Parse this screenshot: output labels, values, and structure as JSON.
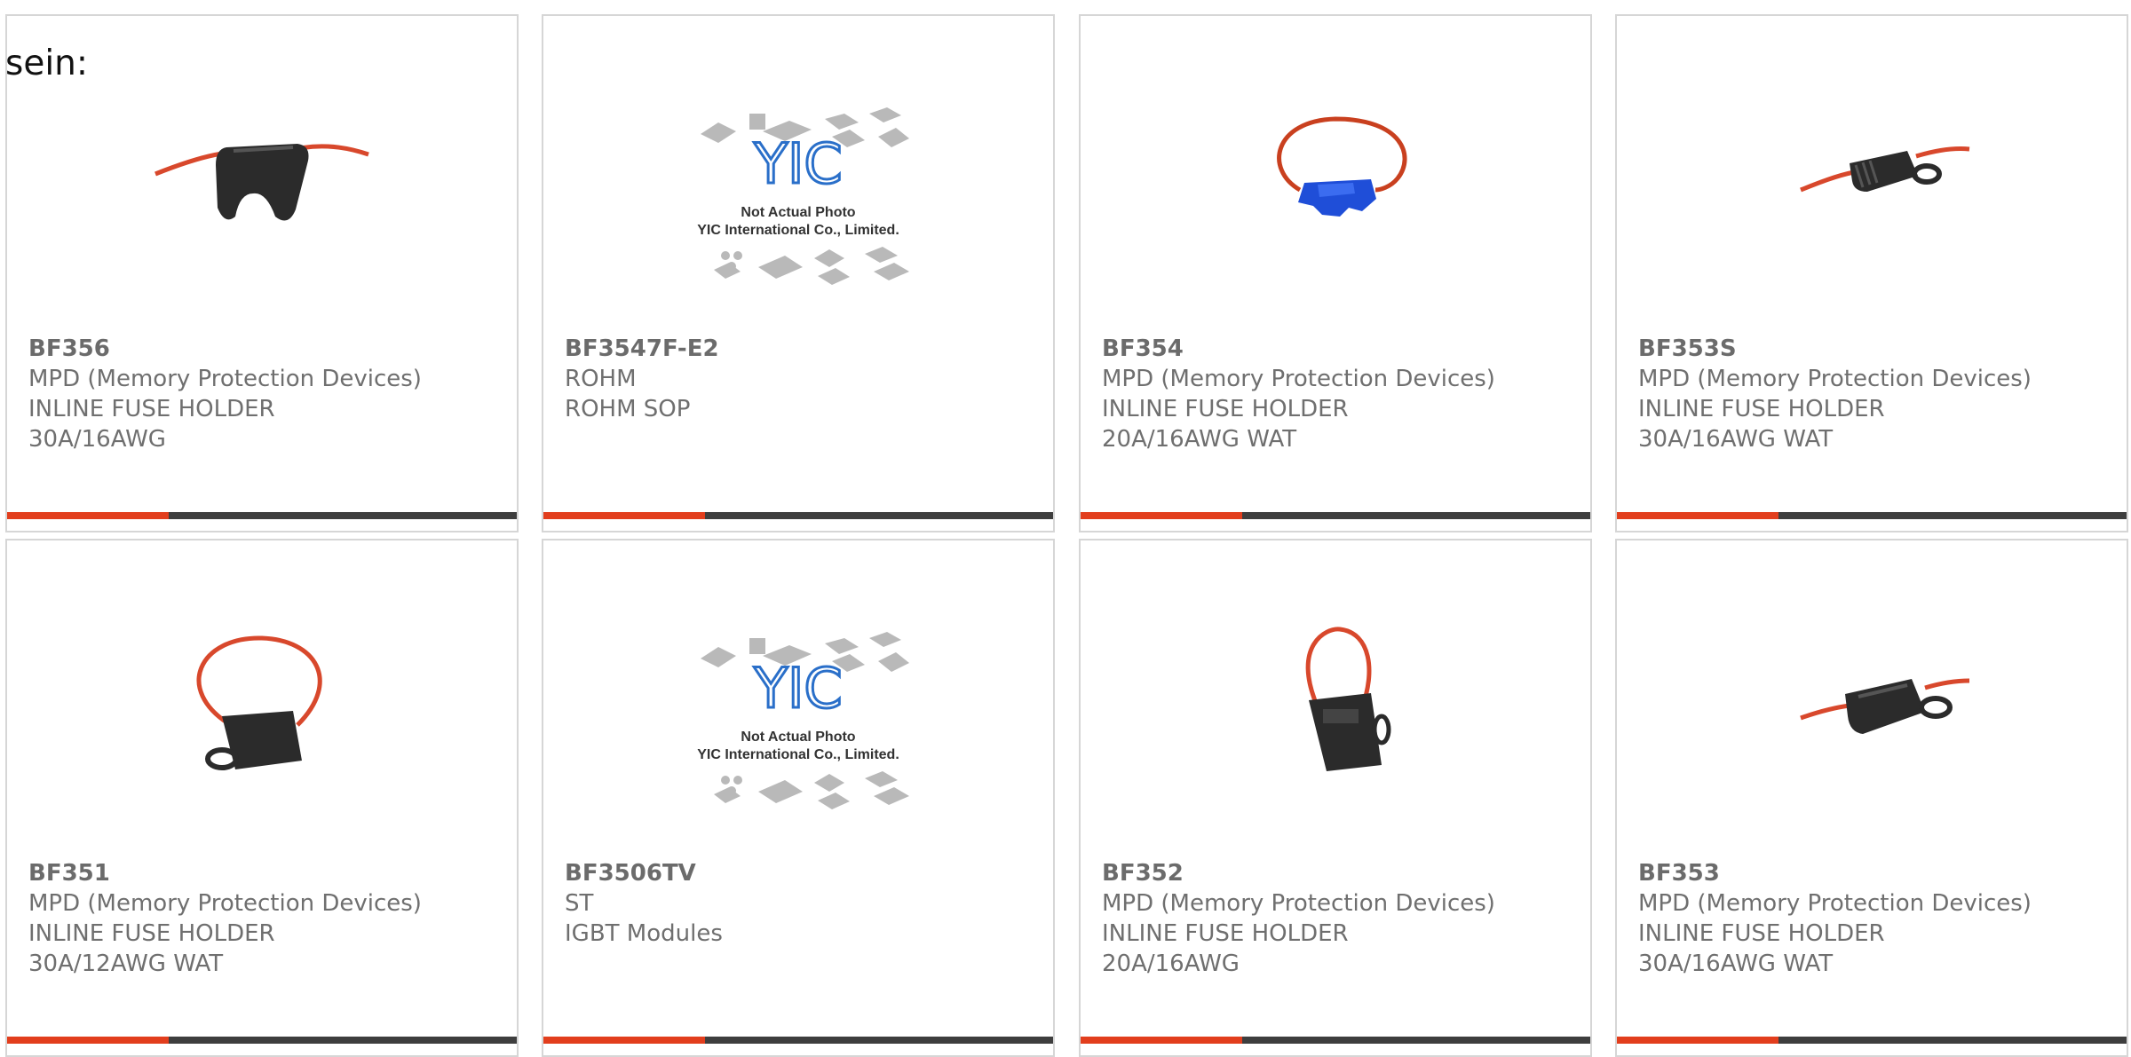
{
  "intro": "sein:",
  "colors": {
    "accent": "#e23e1d",
    "bar": "#3e3e3e",
    "wire": "#d8482c"
  },
  "placeholder_image": {
    "line1": "Not Actual Photo",
    "line2": "YIC International Co., Limited.",
    "logo": "YIC"
  },
  "products": [
    {
      "part": "BF356",
      "line1": "MPD (Memory Protection Devices)",
      "line2": "INLINE FUSE HOLDER",
      "line3": "30A/16AWG",
      "image": "black-fuse-holder-icon"
    },
    {
      "part": "BF3547F-E2",
      "line1": "ROHM",
      "line2": "ROHM SOP",
      "line3": "",
      "image": "yic-placeholder-icon"
    },
    {
      "part": "BF354",
      "line1": "MPD (Memory Protection Devices)",
      "line2": "INLINE FUSE HOLDER",
      "line3": "20A/16AWG WAT",
      "image": "blue-fuse-holder-icon"
    },
    {
      "part": "BF353S",
      "line1": "MPD (Memory Protection Devices)",
      "line2": "INLINE FUSE HOLDER",
      "line3": "30A/16AWG WAT",
      "image": "black-fuse-holder-icon"
    },
    {
      "part": "BF351",
      "line1": "MPD (Memory Protection Devices)",
      "line2": "INLINE FUSE HOLDER",
      "line3": "30A/12AWG WAT",
      "image": "black-fuse-holder-icon"
    },
    {
      "part": "BF3506TV",
      "line1": "ST",
      "line2": "IGBT Modules",
      "line3": "",
      "image": "yic-placeholder-icon"
    },
    {
      "part": "BF352",
      "line1": "MPD (Memory Protection Devices)",
      "line2": "INLINE FUSE HOLDER",
      "line3": "20A/16AWG",
      "image": "black-fuse-holder-icon"
    },
    {
      "part": "BF353",
      "line1": "MPD (Memory Protection Devices)",
      "line2": "INLINE FUSE HOLDER",
      "line3": "30A/16AWG WAT",
      "image": "black-fuse-holder-icon"
    }
  ]
}
